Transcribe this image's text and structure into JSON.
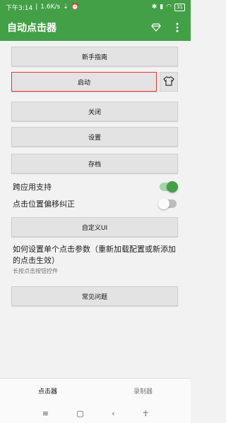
{
  "status_bar": {
    "time": "下午3:14",
    "net_speed": "1.6K/s",
    "battery": "31"
  },
  "app_bar": {
    "title": "自动点击器"
  },
  "buttons": {
    "guide": "新手指南",
    "start": "启动",
    "close": "关闭",
    "settings": "设置",
    "archive": "存档",
    "custom_ui": "自定义UI",
    "faq": "常见问题"
  },
  "switches": {
    "cross_app": {
      "label": "跨应用支持",
      "on": true
    },
    "offset_fix": {
      "label": "点击位置偏移纠正",
      "on": false
    }
  },
  "help": {
    "title": "如何设置单个点击参数（重新加载配置或新添加的点击生效）",
    "subtitle": "长按点击按钮控件"
  },
  "bottom_nav": {
    "clicker": "点击器",
    "recorder": "录制器"
  },
  "colors": {
    "primary": "#43a047",
    "highlight": "#e53935"
  }
}
